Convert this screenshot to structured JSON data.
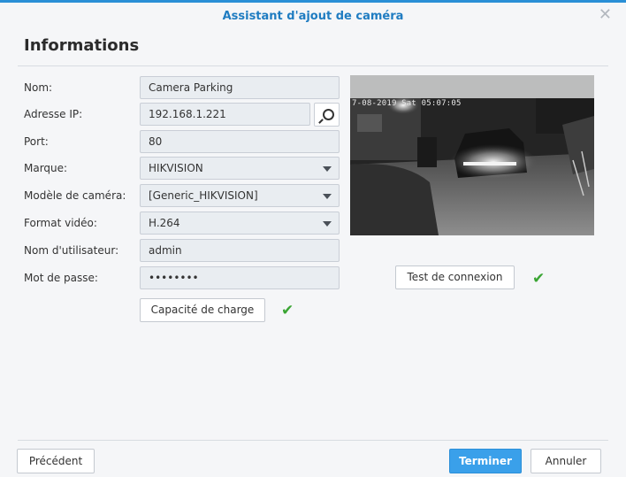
{
  "window": {
    "title": "Assistant d'ajout de caméra",
    "close_glyph": "✕"
  },
  "section": {
    "heading": "Informations"
  },
  "form": {
    "name_label": "Nom:",
    "name_value": "Camera Parking",
    "ip_label": "Adresse IP:",
    "ip_value": "192.168.1.221",
    "port_label": "Port:",
    "port_value": "80",
    "brand_label": "Marque:",
    "brand_value": "HIKVISION",
    "model_label": "Modèle de caméra:",
    "model_value": "[Generic_HIKVISION]",
    "video_label": "Format vidéo:",
    "video_value": "H.264",
    "user_label": "Nom d'utilisateur:",
    "user_value": "admin",
    "password_label": "Mot de passe:",
    "password_value": "••••••••",
    "capacity_button": "Capacité de charge"
  },
  "preview": {
    "timestamp_overlay": "7-08-2019 Sat 05:07:05",
    "test_button": "Test de connexion"
  },
  "status": {
    "check_glyph": "✔",
    "ok_color": "#3aa534"
  },
  "footer": {
    "previous": "Précédent",
    "finish": "Terminer",
    "cancel": "Annuler"
  },
  "colors": {
    "accent": "#2a8fd6",
    "primary_button": "#3aa0ea"
  }
}
